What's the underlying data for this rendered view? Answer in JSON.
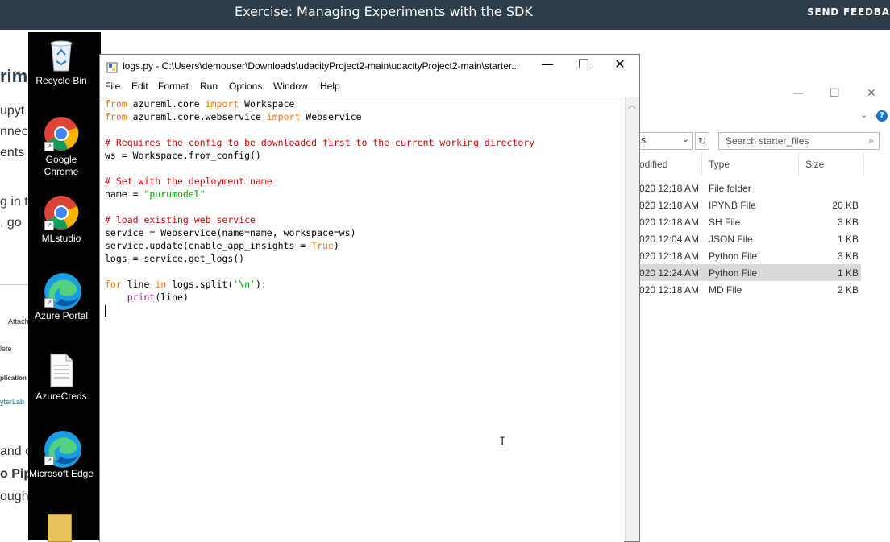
{
  "topbar": {
    "title": "Exercise: Managing Experiments with the SDK",
    "feedback": "SEND FEEDBA"
  },
  "bgpage": {
    "fragments": [
      "rime",
      "upyt",
      "nnec",
      "ents",
      "g in th",
      ", go",
      "Attach",
      "lete",
      "plication",
      "yterLab",
      "and c",
      "o Pip",
      "ough"
    ]
  },
  "desktop": {
    "icons": [
      {
        "label": "Recycle Bin",
        "icon": "recycle-bin-icon"
      },
      {
        "label": "Google Chrome",
        "icon": "chrome-icon"
      },
      {
        "label": "MLstudio",
        "icon": "chrome-icon"
      },
      {
        "label": "Azure Portal",
        "icon": "edge-icon"
      },
      {
        "label": "AzureCreds",
        "icon": "document-icon"
      },
      {
        "label": "Microsoft Edge",
        "icon": "edge-icon"
      }
    ]
  },
  "explorer": {
    "address_fragment": "s",
    "search_placeholder": "Search starter_files",
    "columns": [
      "odified",
      "Type",
      "Size"
    ],
    "rows": [
      {
        "modified": "020 12:18 AM",
        "type": "File folder",
        "size": ""
      },
      {
        "modified": "020 12:18 AM",
        "type": "IPYNB File",
        "size": "20 KB"
      },
      {
        "modified": "020 12:18 AM",
        "type": "SH File",
        "size": "3 KB"
      },
      {
        "modified": "020 12:04 AM",
        "type": "JSON File",
        "size": "1 KB"
      },
      {
        "modified": "020 12:18 AM",
        "type": "Python File",
        "size": "3 KB"
      },
      {
        "modified": "020 12:24 AM",
        "type": "Python File",
        "size": "1 KB",
        "selected": true
      },
      {
        "modified": "020 12:18 AM",
        "type": "MD File",
        "size": "2 KB"
      }
    ]
  },
  "editor": {
    "title": "logs.py - C:\\Users\\demouser\\Downloads\\udacityProject2-main\\udacityProject2-main\\starter...",
    "menu": [
      "File",
      "Edit",
      "Format",
      "Run",
      "Options",
      "Window",
      "Help"
    ],
    "code_lines": [
      [
        {
          "t": "kw",
          "v": "from"
        },
        {
          "t": "",
          "v": " azureml.core "
        },
        {
          "t": "kw",
          "v": "import"
        },
        {
          "t": "",
          "v": " Workspace"
        }
      ],
      [
        {
          "t": "kw",
          "v": "from"
        },
        {
          "t": "",
          "v": " azureml.core.webservice "
        },
        {
          "t": "kw",
          "v": "import"
        },
        {
          "t": "",
          "v": " Webservice"
        }
      ],
      [],
      [
        {
          "t": "cm",
          "v": "# Requires the config to be downloaded first to the current working directory"
        }
      ],
      [
        {
          "t": "",
          "v": "ws = Workspace.from_config()"
        }
      ],
      [],
      [
        {
          "t": "cm",
          "v": "# Set with the deployment name"
        }
      ],
      [
        {
          "t": "",
          "v": "name = "
        },
        {
          "t": "st",
          "v": "\"purumodel\""
        }
      ],
      [],
      [
        {
          "t": "cm",
          "v": "# load existing web service"
        }
      ],
      [
        {
          "t": "",
          "v": "service = Webservice(name=name, workspace=ws)"
        }
      ],
      [
        {
          "t": "",
          "v": "service.update(enable_app_insights = "
        },
        {
          "t": "kw",
          "v": "True"
        },
        {
          "t": "",
          "v": ")"
        }
      ],
      [
        {
          "t": "",
          "v": "logs = service.get_logs()"
        }
      ],
      [],
      [
        {
          "t": "kw",
          "v": "for"
        },
        {
          "t": "",
          "v": " line "
        },
        {
          "t": "kw",
          "v": "in"
        },
        {
          "t": "",
          "v": " logs.split("
        },
        {
          "t": "st",
          "v": "'\\n'"
        },
        {
          "t": "",
          "v": "):"
        }
      ],
      [
        {
          "t": "",
          "v": "    "
        },
        {
          "t": "bi",
          "v": "print"
        },
        {
          "t": "",
          "v": "(line)"
        }
      ]
    ]
  }
}
